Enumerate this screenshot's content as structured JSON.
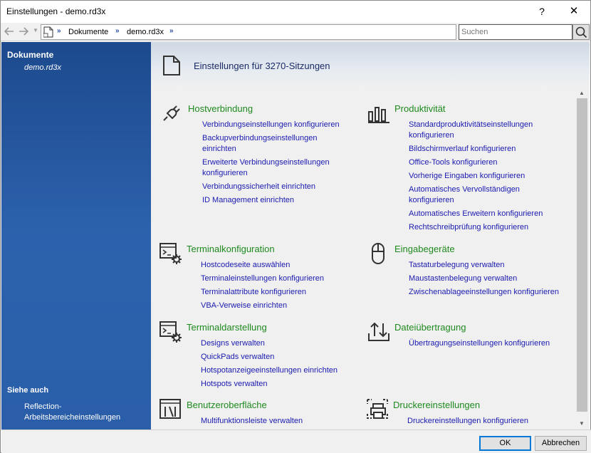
{
  "window": {
    "title": "Einstellungen - demo.rd3x",
    "help_label": "?",
    "close_label": "✕"
  },
  "addressbar": {
    "crumbs": [
      "Dokumente",
      "demo.rd3x"
    ],
    "search_placeholder": "Suchen"
  },
  "sidebar": {
    "title": "Dokumente",
    "item": "demo.rd3x",
    "see_also_title": "Siehe auch",
    "see_also_link": "Reflection-Arbeitsbereicheinstellungen"
  },
  "header": {
    "title": "Einstellungen für 3270-Sitzungen"
  },
  "sections": {
    "host": {
      "title": "Hostverbindung",
      "icon": "plug-icon",
      "links": [
        "Verbindungseinstellungen konfigurieren",
        "Backupverbindungseinstellungen einrichten",
        "Erweiterte Verbindungseinstellungen konfigurieren",
        "Verbindungssicherheit einrichten",
        "ID Management einrichten"
      ]
    },
    "productivity": {
      "title": "Produktivität",
      "icon": "bar-chart-icon",
      "links": [
        "Standardproduktivitätseinstellungen konfigurieren",
        "Bildschirmverlauf konfigurieren",
        "Office-Tools konfigurieren",
        "Vorherige Eingaben konfigurieren",
        "Automatisches Vervollständigen konfigurieren",
        "Automatisches Erweitern konfigurieren",
        "Rechtschreibprüfung konfigurieren"
      ]
    },
    "terminalconfig": {
      "title": "Terminalkonfiguration",
      "icon": "terminal-gear-icon",
      "links": [
        "Hostcodeseite auswählen",
        "Terminaleinstellungen konfigurieren",
        "Terminalattribute konfigurieren",
        "VBA-Verweise einrichten"
      ]
    },
    "input": {
      "title": "Eingabegeräte",
      "icon": "mouse-icon",
      "links": [
        "Tastaturbelegung verwalten",
        "Maustastenbelegung verwalten",
        "Zwischenablageeinstellungen konfigurieren"
      ]
    },
    "display": {
      "title": "Terminaldarstellung",
      "icon": "terminal-gear-icon",
      "links": [
        "Designs verwalten",
        "QuickPads verwalten",
        "Hotspotanzeigeeinstellungen einrichten",
        "Hotspots verwalten"
      ]
    },
    "transfer": {
      "title": "Dateiübertragung",
      "icon": "transfer-icon",
      "links": [
        "Übertragungseinstellungen konfigurieren"
      ]
    },
    "ui": {
      "title": "Benutzeroberfläche",
      "icon": "ui-tools-icon",
      "links": [
        "Multifunktionsleiste verwalten"
      ]
    },
    "print": {
      "title": "Druckereinstellungen",
      "icon": "printer-icon",
      "links": [
        "Druckereinstellungen konfigurieren"
      ]
    }
  },
  "footer": {
    "ok_label": "OK",
    "cancel_label": "Abbrechen"
  }
}
